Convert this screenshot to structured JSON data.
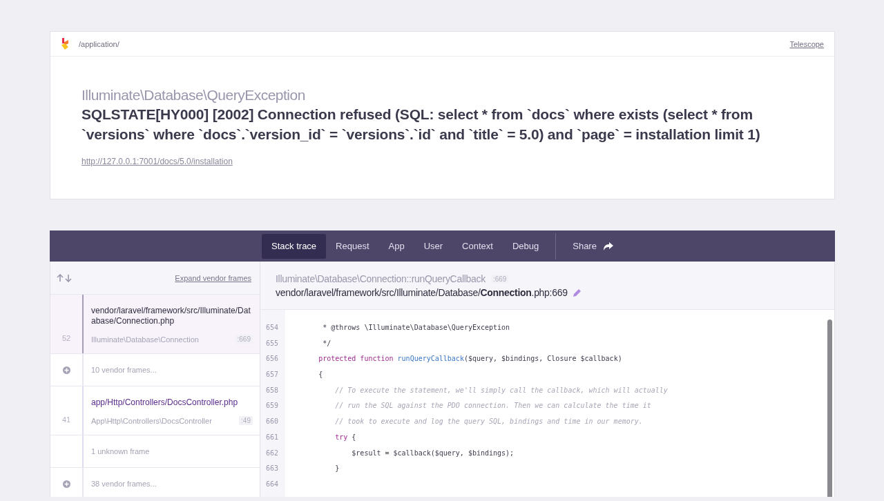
{
  "header": {
    "path": "/application/",
    "link": "Telescope"
  },
  "exception": {
    "class": "Illuminate\\Database\\QueryException",
    "message": "SQLSTATE[HY000] [2002] Connection refused (SQL: select * from `docs` where exists (select * from `versions` where `docs`.`version_id` = `versions`.`id` and `title` = 5.0) and `page` = installation limit 1)",
    "url": "http://127.0.0.1:7001/docs/5.0/installation"
  },
  "tabs": [
    {
      "label": "Stack trace",
      "selected": true
    },
    {
      "label": "Request",
      "selected": false
    },
    {
      "label": "App",
      "selected": false
    },
    {
      "label": "User",
      "selected": false
    },
    {
      "label": "Context",
      "selected": false
    },
    {
      "label": "Debug",
      "selected": false
    }
  ],
  "share": {
    "label": "Share"
  },
  "frames_toolbar": {
    "expand": "Expand vendor frames"
  },
  "frames": [
    {
      "kind": "vendor-frame",
      "number": "52",
      "file": "vendor/laravel/framework/src/Illuminate/Database/Connection.php",
      "class": "Illuminate\\Database\\Connection",
      "line": ":669",
      "selected": true
    },
    {
      "kind": "vendor-group",
      "label": "10 vendor frames..."
    },
    {
      "kind": "app-frame",
      "number": "41",
      "file": "app/Http/Controllers/DocsController.php",
      "class": "App\\Http\\Controllers\\DocsController",
      "line": ":49",
      "selected": false
    },
    {
      "kind": "unknown",
      "label": "1 unknown frame"
    },
    {
      "kind": "vendor-group",
      "label": "38 vendor frames..."
    }
  ],
  "frame_detail": {
    "method": "Illuminate\\Database\\Connection::runQueryCallback",
    "line": ":669",
    "file": "vendor/laravel/framework/src/Illuminate/Database/**Connection**.php:669"
  },
  "code": [
    {
      "number": "654",
      "tokens": [
        {
          "kind": "plain",
          "text": "         * @throws \\Illuminate\\Database\\QueryException"
        }
      ]
    },
    {
      "number": "655",
      "tokens": [
        {
          "kind": "plain",
          "text": "         */"
        }
      ]
    },
    {
      "number": "656",
      "tokens": [
        {
          "kind": "keyword",
          "text": "        protected function"
        },
        {
          "kind": "function",
          "text": " runQueryCallback"
        },
        {
          "kind": "plain",
          "text": "($query, $bindings, Closure $callback)"
        }
      ]
    },
    {
      "number": "657",
      "tokens": [
        {
          "kind": "plain",
          "text": "        {"
        }
      ]
    },
    {
      "number": "658",
      "tokens": [
        {
          "kind": "comment",
          "text": "            // To execute the statement, we'll simply call the callback, which will actually"
        }
      ]
    },
    {
      "number": "659",
      "tokens": [
        {
          "kind": "comment",
          "text": "            // run the SQL against the PDO connection. Then we can calculate the time it"
        }
      ]
    },
    {
      "number": "660",
      "tokens": [
        {
          "kind": "comment",
          "text": "            // took to execute and log the query SQL, bindings and time in our memory."
        }
      ]
    },
    {
      "number": "661",
      "tokens": [
        {
          "kind": "keyword",
          "text": "            try"
        },
        {
          "kind": "plain",
          "text": " {"
        }
      ]
    },
    {
      "number": "662",
      "tokens": [
        {
          "kind": "plain",
          "text": "                $result = $callback($query, $bindings);"
        }
      ]
    },
    {
      "number": "663",
      "tokens": [
        {
          "kind": "plain",
          "text": "            }"
        }
      ]
    },
    {
      "number": "664"
    }
  ]
}
